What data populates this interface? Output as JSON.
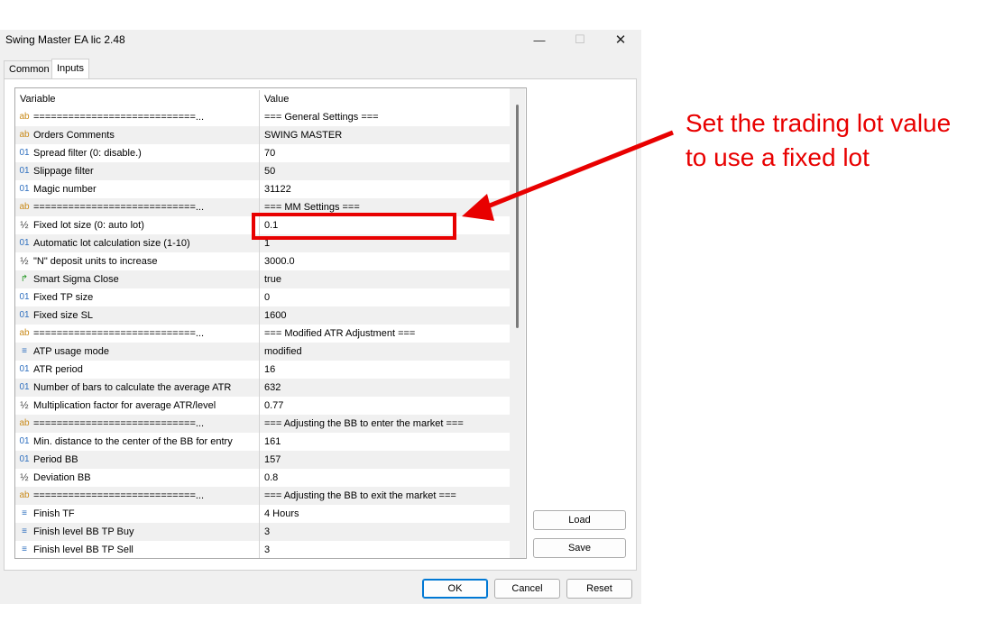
{
  "window": {
    "title": "Swing Master EA lic 2.48",
    "minimize": "—",
    "maximize": "☐",
    "close": "✕"
  },
  "tabs": [
    {
      "label": "Common"
    },
    {
      "label": "Inputs"
    }
  ],
  "grid": {
    "headers": {
      "variable": "Variable",
      "value": "Value"
    },
    "rows": [
      {
        "icon": "ab",
        "name": "============================...",
        "value": "=== General Settings ==="
      },
      {
        "icon": "ab",
        "name": "Orders Comments",
        "value": "SWING MASTER"
      },
      {
        "icon": "01",
        "name": "Spread filter (0: disable.)",
        "value": "70"
      },
      {
        "icon": "01",
        "name": "Slippage filter",
        "value": "50"
      },
      {
        "icon": "01",
        "name": "Magic number",
        "value": "31122"
      },
      {
        "icon": "ab",
        "name": "============================...",
        "value": "=== MM Settings ==="
      },
      {
        "icon": "½",
        "name": "Fixed lot size (0: auto lot)",
        "value": "0.1"
      },
      {
        "icon": "01",
        "name": "Automatic lot calculation size (1-10)",
        "value": "1"
      },
      {
        "icon": "½",
        "name": "\"N\" deposit units to increase",
        "value": "3000.0"
      },
      {
        "icon": "↱",
        "name": "Smart Sigma Close",
        "value": "true"
      },
      {
        "icon": "01",
        "name": "Fixed TP size",
        "value": "0"
      },
      {
        "icon": "01",
        "name": "Fixed size SL",
        "value": "1600"
      },
      {
        "icon": "ab",
        "name": "============================...",
        "value": "=== Modified ATR Adjustment ==="
      },
      {
        "icon": "≡",
        "name": "ATP usage mode",
        "value": "modified"
      },
      {
        "icon": "01",
        "name": "ATR period",
        "value": "16"
      },
      {
        "icon": "01",
        "name": "Number of bars to calculate the average ATR",
        "value": "632"
      },
      {
        "icon": "½",
        "name": "Multiplication factor for average ATR/level",
        "value": "0.77"
      },
      {
        "icon": "ab",
        "name": "============================...",
        "value": "=== Adjusting the BB to enter the market ==="
      },
      {
        "icon": "01",
        "name": "Min. distance to the center of the BB for entry",
        "value": "161"
      },
      {
        "icon": "01",
        "name": "Period BB",
        "value": "157"
      },
      {
        "icon": "½",
        "name": "Deviation BB",
        "value": "0.8"
      },
      {
        "icon": "ab",
        "name": "============================...",
        "value": "=== Adjusting the BB to exit the market ==="
      },
      {
        "icon": "≡",
        "name": "Finish TF",
        "value": "4 Hours"
      },
      {
        "icon": "≡",
        "name": "Finish level BB TP Buy",
        "value": "3"
      },
      {
        "icon": "≡",
        "name": "Finish level BB TP Sell",
        "value": "3"
      }
    ]
  },
  "side_buttons": {
    "load": "Load",
    "save": "Save"
  },
  "footer_buttons": {
    "ok": "OK",
    "cancel": "Cancel",
    "reset": "Reset"
  },
  "annotation": {
    "line1": "Set the trading lot value",
    "line2": "to use a fixed lot",
    "color": "#e80000"
  }
}
